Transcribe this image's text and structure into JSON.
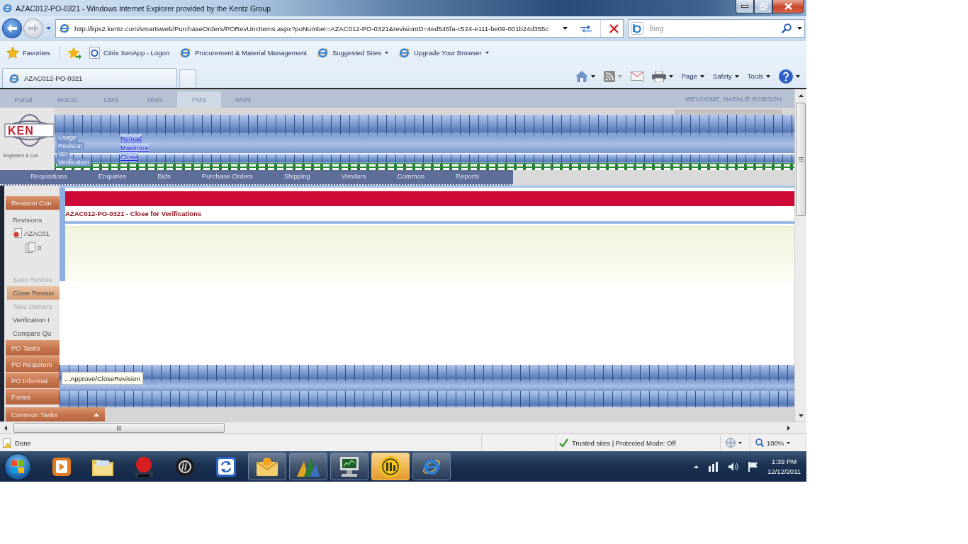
{
  "window": {
    "title": "AZAC012-PO-0321 - Windows Internet Explorer provided by the Kentz Group"
  },
  "nav_buttons": [
    {
      "kind": "back",
      "disabled": false
    },
    {
      "kind": "forward",
      "disabled": true
    }
  ],
  "address_bar": {
    "url": "http://kps2.kentz.com/smartsweb/PurchaseOrders/PORevUncItems.aspx?poNumber=AZAC012-PO-0321&revisionID=4ed545fa-c524-e111-be09-001b24d355c",
    "search_placeholder": "Bing"
  },
  "favorites_bar": {
    "label": "Favorites",
    "links": [
      {
        "label": "Citrix XenApp - Logon",
        "kind": "page",
        "dropdown": false
      },
      {
        "label": "Procurement & Material Management",
        "kind": "ie",
        "dropdown": false
      },
      {
        "label": "Suggested Sites",
        "kind": "ie",
        "dropdown": true
      },
      {
        "label": "Upgrade Your Browser",
        "kind": "ie",
        "dropdown": true
      }
    ]
  },
  "tabs": [
    {
      "label": "AZAC012-PO-0321",
      "selected": true
    }
  ],
  "command_bar": [
    {
      "kind": "home",
      "dropdown": true
    },
    {
      "kind": "feeds",
      "dropdown": true
    },
    {
      "kind": "mail",
      "dropdown": false
    },
    {
      "kind": "print",
      "dropdown": true
    },
    {
      "kind": "menu",
      "label": "Page",
      "dropdown": true
    },
    {
      "kind": "menu",
      "label": "Safety",
      "dropdown": true
    },
    {
      "kind": "menu",
      "label": "Tools",
      "dropdown": true
    },
    {
      "kind": "help",
      "dropdown": true
    }
  ],
  "page": {
    "top_nav": [
      {
        "label": "Portal",
        "selected": false
      },
      {
        "label": "MoCat",
        "selected": false
      },
      {
        "label": "CMS",
        "selected": false
      },
      {
        "label": "MMS",
        "selected": false
      },
      {
        "label": "PMS",
        "selected": true
      },
      {
        "label": "WMS",
        "selected": false
      }
    ],
    "welcome": "WELCOME, NATALIE ROBSON",
    "logo": {
      "name": "KEN",
      "tagline": "Engineers & Con"
    },
    "window_menu": {
      "labels": [
        "Usage",
        "Revision",
        "Ver",
        "Verification"
      ],
      "links": [
        "Reload",
        "Maximize",
        "Close"
      ]
    },
    "main_menu": [
      "Requisitions",
      "Enquiries",
      "Bids",
      "Purchase Orders",
      "Shipping",
      "Vendors",
      "Common",
      "Reports"
    ],
    "sidebar": {
      "title": "Revision Con",
      "tree_heading": "Revisions",
      "tree": [
        {
          "label": "AZAC01",
          "kind": "revision",
          "children": [
            {
              "label": "0",
              "kind": "document"
            }
          ]
        }
      ],
      "tasks": [
        {
          "label": "Save Revisio",
          "disabled": true,
          "selected": false
        },
        {
          "label": "Close Revisio",
          "disabled": false,
          "selected": true
        },
        {
          "label": "Take Owners",
          "disabled": true,
          "selected": false
        },
        {
          "label": "Verification I",
          "disabled": false,
          "selected": false
        },
        {
          "label": "Compare Qu",
          "disabled": false,
          "selected": false
        }
      ],
      "panels": [
        "PO Tasks",
        "PO Requirem",
        "PO Informat",
        "Forms"
      ],
      "common_tasks": {
        "title": "Common Tasks",
        "expanded": true
      }
    },
    "dialog": {
      "title": "AZAC012-PO-0321 - Close for Verifications"
    },
    "minimized_window": {
      "title": "...Approve/CloseRevision"
    }
  },
  "status_bar": {
    "text": "Done",
    "zone": "Trusted sites | Protected Mode: Off",
    "zoom": "100%"
  },
  "taskbar": {
    "apps": [
      {
        "kind": "player",
        "running": false,
        "selected": false
      },
      {
        "kind": "folder",
        "running": false,
        "selected": false
      },
      {
        "kind": "record",
        "running": false,
        "selected": false
      },
      {
        "kind": "round-logo",
        "running": false,
        "selected": false
      },
      {
        "kind": "sync",
        "running": false,
        "selected": false
      },
      {
        "kind": "mail",
        "running": true,
        "selected": false
      },
      {
        "kind": "chart",
        "running": true,
        "selected": false
      },
      {
        "kind": "monitor",
        "running": true,
        "selected": false
      },
      {
        "kind": "coin",
        "running": true,
        "selected": true
      },
      {
        "kind": "browser",
        "running": true,
        "selected": false
      }
    ],
    "time": "1:39 PM",
    "date": "12/12/2011"
  }
}
